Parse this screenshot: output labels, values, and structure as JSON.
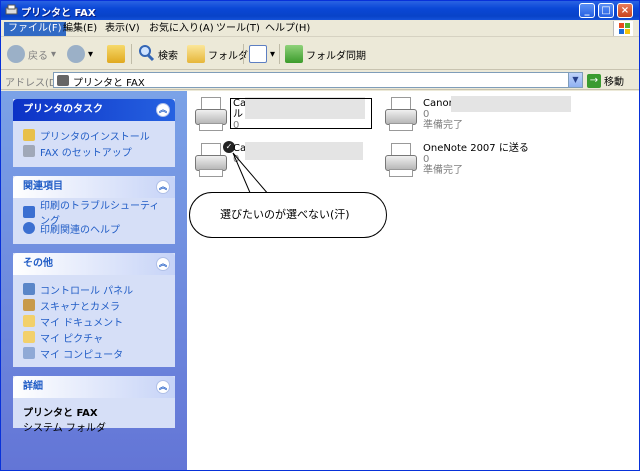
{
  "window": {
    "title": "プリンタと FAX"
  },
  "titlebar_buttons": {
    "minimize": "_",
    "maximize": "□",
    "close": "×"
  },
  "menu": [
    "ファイル(F)",
    "編集(E)",
    "表示(V)",
    "お気に入り(A)",
    "ツール(T)",
    "ヘルプ(H)"
  ],
  "toolbar": {
    "back": "戻る",
    "search": "検索",
    "folders": "フォルダ",
    "sync": "フォルダ同期"
  },
  "address": {
    "label": "アドレス(D)",
    "value": "プリンタと FAX",
    "go": "移動"
  },
  "sidebar": {
    "printer_tasks": {
      "title": "プリンタのタスク",
      "items": [
        "プリンタのインストール",
        "FAX のセットアップ"
      ]
    },
    "related": {
      "title": "関連項目",
      "items": [
        "印刷のトラブルシューティング",
        "印刷関連のヘルプ"
      ]
    },
    "other": {
      "title": "その他",
      "items": [
        "コントロール パネル",
        "スキャナとカメラ",
        "マイ ドキュメント",
        "マイ ピクチャ",
        "マイ コンピュータ"
      ]
    },
    "details": {
      "title": "詳細",
      "name": "プリンタと FAX",
      "type": "システム フォルダ"
    }
  },
  "printers": [
    {
      "name": "Ca",
      "name2": "ルト",
      "docs": "0",
      "status": ""
    },
    {
      "name": "Canon",
      "docs": "0",
      "status": "準備完了"
    },
    {
      "name": "Ca",
      "docs": "0",
      "status": ""
    },
    {
      "name": "OneNote 2007 に送る",
      "docs": "0",
      "status": "準備完了"
    }
  ],
  "callout": {
    "text": "選びたいのが選べない(汗)"
  }
}
